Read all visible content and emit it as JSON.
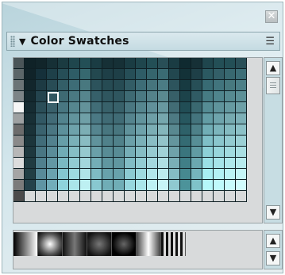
{
  "panel": {
    "title": "Color Swatches",
    "collapse_icon": "triangle-down-icon",
    "menu_icon": "panel-menu-icon",
    "close_icon": "close-icon"
  },
  "swatches": {
    "columns": 21,
    "rows": 13,
    "selected_swatch": "row 4, column 4",
    "colors": [
      [
        "#4a5558",
        "#0f2227",
        "#11252a",
        "#163036",
        "#1b3b41",
        "#1f464d",
        "#234f56",
        "#1a3c43",
        "#163036",
        "#163036",
        "#1a3c43",
        "#1f464d",
        "#234f56",
        "#294f57",
        "#1a3c43",
        "#0f2a30",
        "#163036",
        "#1f464d",
        "#234f56",
        "#234f56",
        "#294f57"
      ],
      [
        "#5b6669",
        "#102329",
        "#15303a",
        "#1e4049",
        "#264e57",
        "#2e5c66",
        "#36686f",
        "#23484f",
        "#1e3f47",
        "#1e3f47",
        "#264e57",
        "#2e5c66",
        "#35656d",
        "#3a6b73",
        "#22474f",
        "#133238",
        "#1e3f47",
        "#2b5961",
        "#335f68",
        "#386870",
        "#3d6e77"
      ],
      [
        "#6b7477",
        "#12262c",
        "#1d3a43",
        "#284c55",
        "#335e67",
        "#3d6c76",
        "#48787f",
        "#2c535c",
        "#264b53",
        "#264b53",
        "#325c65",
        "#3d6c76",
        "#46757d",
        "#4b7c84",
        "#2d545d",
        "#173a41",
        "#274f57",
        "#386b74",
        "#41747d",
        "#47797f",
        "#4c7f87"
      ],
      [
        "#7c8487",
        "#14292f",
        "#24444e",
        "#315660",
        "#3e6a73",
        "#4a7982",
        "#56858d",
        "#36606a",
        "#2f565f",
        "#2f565f",
        "#3e6a73",
        "#4a7982",
        "#54828a",
        "#5a8990",
        "#375f68",
        "#1c434a",
        "#305b64",
        "#467b83",
        "#4f858d",
        "#568a91",
        "#5c9097"
      ],
      [
        "#f6f6f6",
        "#162c32",
        "#2b4e58",
        "#39606b",
        "#487681",
        "#56868f",
        "#63929a",
        "#416d77",
        "#38616a",
        "#38616a",
        "#4a7781",
        "#56868f",
        "#61909a",
        "#6898a0",
        "#426c75",
        "#214d55",
        "#3a6870",
        "#558c94",
        "#5f949c",
        "#669aa1",
        "#6da0a7"
      ],
      [
        "#9ea1a2",
        "#182f35",
        "#325864",
        "#426b77",
        "#52838e",
        "#62949d",
        "#6fa0a7",
        "#4b7984",
        "#406b75",
        "#406b75",
        "#55848e",
        "#62949d",
        "#6e9fa7",
        "#76a7ae",
        "#4e7a83",
        "#27575f",
        "#44747d",
        "#639da5",
        "#6ea4ac",
        "#76aab0",
        "#7db0b7"
      ],
      [
        "#6c6c6c",
        "#1a3238",
        "#3a626e",
        "#4a7682",
        "#5c909b",
        "#6ea2ab",
        "#7caeb4",
        "#55858f",
        "#48767f",
        "#48767f",
        "#60929b",
        "#6ea2ab",
        "#7baeb5",
        "#84b6bc",
        "#598890",
        "#2e6169",
        "#4e8189",
        "#71aeb6",
        "#7cb5bc",
        "#84bbc1",
        "#8cc1c7"
      ],
      [
        "#8a8a8a",
        "#1c353b",
        "#416c79",
        "#52818e",
        "#669ea8",
        "#7ab0b8",
        "#89bcc2",
        "#60939c",
        "#50818a",
        "#50818a",
        "#6ba0a9",
        "#7ab0b8",
        "#89bdc4",
        "#93c4ca",
        "#64959d",
        "#346b73",
        "#578e96",
        "#7fbfc7",
        "#8ac6cd",
        "#93cbd1",
        "#9bd0d5"
      ],
      [
        "#b7b7b7",
        "#1e383e",
        "#497683",
        "#5a8c99",
        "#70acb6",
        "#86bec5",
        "#96cacf",
        "#6aa0a9",
        "#588c95",
        "#588c95",
        "#76aeb7",
        "#86bec5",
        "#97cbd1",
        "#a1d2d7",
        "#6fa2aa",
        "#3a757d",
        "#619ba3",
        "#8dd0d7",
        "#98d6dc",
        "#a1dbe0",
        "#a9dfe3"
      ],
      [
        "#dcdcdc",
        "#203b41",
        "#50808e",
        "#6297a4",
        "#7ab9c3",
        "#92ccd3",
        "#a3d7dc",
        "#74aeb7",
        "#6097a0",
        "#6097a0",
        "#81bcc5",
        "#92ccd3",
        "#a4d8de",
        "#afdfe3",
        "#7aafb7",
        "#407f87",
        "#6ba8b0",
        "#9be0e6",
        "#a6e4e9",
        "#afe8ec",
        "#b7ebee"
      ],
      [
        "#a5a5a5",
        "#223e44",
        "#588a99",
        "#6aa2af",
        "#84c6d0",
        "#9edae0",
        "#b0e4e8",
        "#7ebbc4",
        "#68a2ab",
        "#68a2ab",
        "#8ccad2",
        "#9edae0",
        "#b1e5ea",
        "#bcebee",
        "#85bcc4",
        "#468990",
        "#75b5bd",
        "#a8eef2",
        "#b3f1f4",
        "#bcf3f5",
        "#c4f5f7"
      ],
      [
        "#7b7b7b",
        "#24414a",
        "#5f94a3",
        "#72adba",
        "#8ed3dc",
        "#aae6ea",
        "#bdf0f2",
        "#88c8d0",
        "#70adb6",
        "#70adb6",
        "#97d7de",
        "#aae6ea",
        "#bef1f4",
        "#c9f5f7",
        "#8fc9d0",
        "#4c939a",
        "#7fc2c9",
        "#b6f8fa",
        "#c0fafb",
        "#c9fbfc",
        "#d1fcfd"
      ],
      [
        "#4b4b4b",
        "#d8dadb",
        "#d8dadb",
        "#d8dadb",
        "#d8dadb",
        "#d8dadb",
        "#d8dadb",
        "#d8dadb",
        "#d8dadb",
        "#d8dadb",
        "#d8dadb",
        "#d8dadb",
        "#d8dadb",
        "#d8dadb",
        "#d8dadb",
        "#d8dadb",
        "#d8dadb",
        "#d8dadb",
        "#d8dadb",
        "#d8dadb",
        "#d8dadb"
      ]
    ]
  },
  "gradients": {
    "items": [
      "black-to-white linear",
      "white radial",
      "gray highlight linear",
      "gray radial",
      "dark radial",
      "chrome linear",
      "striped linear"
    ]
  },
  "scroll": {
    "up_icon": "chevron-up-icon",
    "down_icon": "chevron-down-icon",
    "thumb_icon": "scroll-thumb-icon"
  }
}
